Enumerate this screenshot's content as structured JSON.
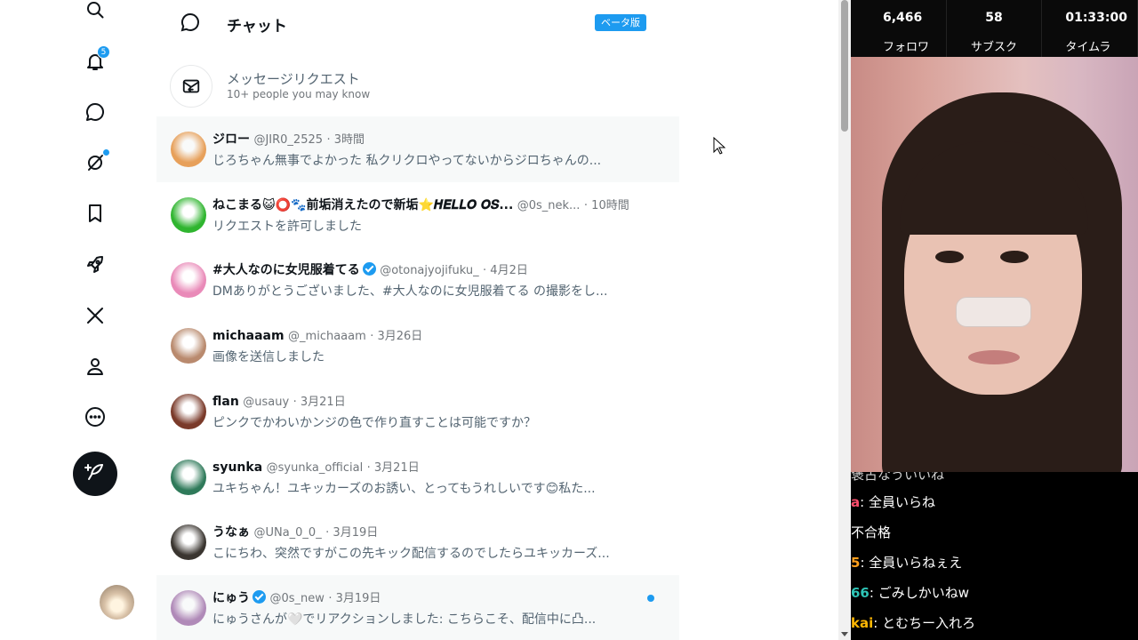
{
  "nav": {
    "notification_count": "5",
    "items": [
      {
        "icon": "search-icon"
      },
      {
        "icon": "bell-icon"
      },
      {
        "icon": "chat-icon"
      },
      {
        "icon": "grok-icon"
      },
      {
        "icon": "bookmark-icon"
      },
      {
        "icon": "rocket-icon"
      },
      {
        "icon": "x-logo-icon"
      },
      {
        "icon": "profile-icon"
      },
      {
        "icon": "more-icon"
      }
    ],
    "compose_icon": "feather-plus-icon"
  },
  "chat": {
    "title": "チャット",
    "beta_label": "ベータ版",
    "request": {
      "title": "メッセージリクエスト",
      "subtitle": "10+ people you may know"
    },
    "conversations": [
      {
        "name": "ジロー",
        "handle": "@JIR0_2525",
        "time": "· 3時間",
        "snippet": "じろちゃん無事でよかった 私クリクロやってないからジロちゃんの...",
        "verified": false,
        "unread": false,
        "avatar_color": "#e7a05a"
      },
      {
        "name": "ねこまる😺⭕🐾前垢消えたので新垢⭐𝑯𝑬𝑳𝑳𝑶 𝑶𝑺...",
        "handle": "@0s_nek...",
        "time": "· 10時間",
        "snippet": "リクエストを許可しました",
        "verified": false,
        "unread": false,
        "avatar_color": "#2fb52f"
      },
      {
        "name": "#大人なのに女児服着てる",
        "handle": "@otonajyojifuku_",
        "time": "· 4月2日",
        "snippet": "DMありがとうございました、#大人なのに女児服着てる の撮影をし...",
        "verified": true,
        "unread": false,
        "avatar_color": "#e98ab8"
      },
      {
        "name": "michaaam",
        "handle": "@_michaaam",
        "time": "· 3月26日",
        "snippet": "画像を送信しました",
        "verified": false,
        "unread": false,
        "avatar_color": "#b98a6e"
      },
      {
        "name": "flan",
        "handle": "@usauy",
        "time": "· 3月21日",
        "snippet": "ピンクでかわいかンジの色で作り直すことは可能ですか？",
        "verified": false,
        "unread": false,
        "avatar_color": "#7a3a2a"
      },
      {
        "name": "syunka",
        "handle": "@syunka_official",
        "time": "· 3月21日",
        "snippet": "ユキちゃん！ユキッカーズのお誘い、とってもうれしいです😊私た...",
        "verified": false,
        "unread": false,
        "avatar_color": "#2f7a5a"
      },
      {
        "name": "うなぁ",
        "handle": "@UNa_0_0_",
        "time": "· 3月19日",
        "snippet": "こにちわ、突然ですがこの先キック配信するのでしたらユキッカーズ...",
        "verified": false,
        "unread": false,
        "avatar_color": "#3a3530"
      },
      {
        "name": "にゅう",
        "handle": "@0s_new",
        "time": "· 3月19日",
        "snippet": "にゅうさんが🤍でリアクションしました: こちらこそ、配信中に凸...",
        "verified": true,
        "unread": true,
        "avatar_color": "#b08ab8"
      }
    ]
  },
  "stream": {
    "stats": [
      {
        "value": "6,466",
        "label": "フォロワ"
      },
      {
        "value": "58",
        "label": "サブスク"
      },
      {
        "value": "01:33:00",
        "label": "タイムラ"
      }
    ],
    "chat_partial_top": "褒古なういいね",
    "chat_lines": [
      {
        "who": "a",
        "text": ": 全員いらね",
        "color": "#ff4d6d"
      },
      {
        "who": "",
        "text": "不合格",
        "color": "#ffffff"
      },
      {
        "who": "5",
        "text": ": 全員いらねぇえ",
        "color": "#ff9f1c"
      },
      {
        "who": "66",
        "text": ": ごみしかいねw",
        "color": "#2ec4b6"
      },
      {
        "who": "kai",
        "text": ": とむちー入れろ",
        "color": "#ffb703"
      }
    ]
  }
}
